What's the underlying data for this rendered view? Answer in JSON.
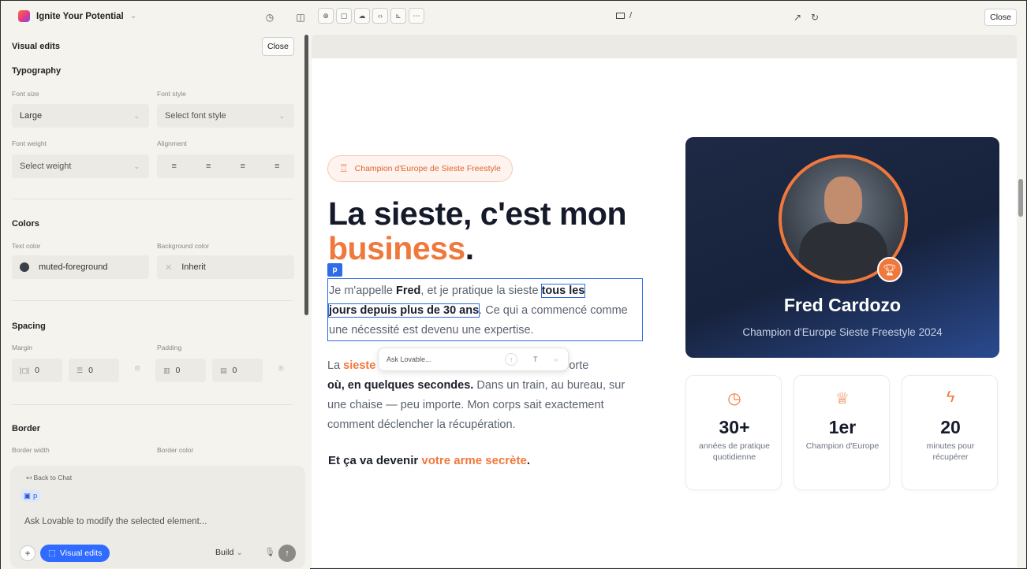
{
  "topbar": {
    "project_name": "Ignite Your Potential",
    "url_path": "/",
    "close_label": "Close"
  },
  "panel": {
    "title": "Visual edits",
    "close_label": "Close",
    "typography": {
      "title": "Typography",
      "font_size_label": "Font size",
      "font_size_value": "Large",
      "font_style_label": "Font style",
      "font_style_value": "Select font style",
      "font_weight_label": "Font weight",
      "font_weight_value": "Select weight",
      "alignment_label": "Alignment"
    },
    "colors": {
      "title": "Colors",
      "text_color_label": "Text color",
      "text_color_value": "muted-foreground",
      "bg_color_label": "Background color",
      "bg_color_value": "Inherit"
    },
    "spacing": {
      "title": "Spacing",
      "margin_label": "Margin",
      "margin_x": "0",
      "margin_y": "0",
      "padding_label": "Padding",
      "padding_x": "0",
      "padding_y": "0"
    },
    "border": {
      "title": "Border",
      "width_label": "Border width",
      "color_label": "Border color"
    },
    "chat": {
      "back_label": "Back to Chat",
      "element_chip": "p",
      "placeholder": "Ask Lovable to modify the selected element...",
      "visual_edits_label": "Visual edits",
      "build_label": "Build"
    }
  },
  "preview": {
    "badge": "Champion d'Europe de Sieste Freestyle",
    "headline_1": "La sieste, c'est mon",
    "headline_2": "business",
    "headline_period": ".",
    "selected_tag": "p",
    "para1": {
      "t1": "Je m'appelle ",
      "name": "Fred",
      "t2": ", et je pratique la sieste ",
      "hl1": "tous les",
      "hl2": "jours depuis plus de 30 ans",
      "t3": ". Ce qui a commencé comme une nécessité est devenu une expertise."
    },
    "para2": {
      "t1": "La ",
      "or1": "sieste",
      "hidden": " ",
      "t2": "r n'importe ",
      "b1": "où, en quelques secondes.",
      "t3": " Dans un train, au bureau, sur une chaise — peu importe. Mon corps sait exactement comment déclencher la récupération."
    },
    "ask_popup": "Ask Lovable...",
    "tagline_1": "Et ça va devenir ",
    "tagline_2": "votre arme secrète",
    "tagline_3": ".",
    "card": {
      "name": "Fred Cardozo",
      "subtitle": "Champion d'Europe Sieste Freestyle 2024"
    },
    "stats": [
      {
        "icon": "clock-icon",
        "value": "30+",
        "label": "années de pratique quotidienne"
      },
      {
        "icon": "trophy-icon",
        "value": "1er",
        "label": "Champion d'Europe"
      },
      {
        "icon": "lightning-icon",
        "value": "20",
        "label": "minutes pour récupérer"
      }
    ]
  }
}
